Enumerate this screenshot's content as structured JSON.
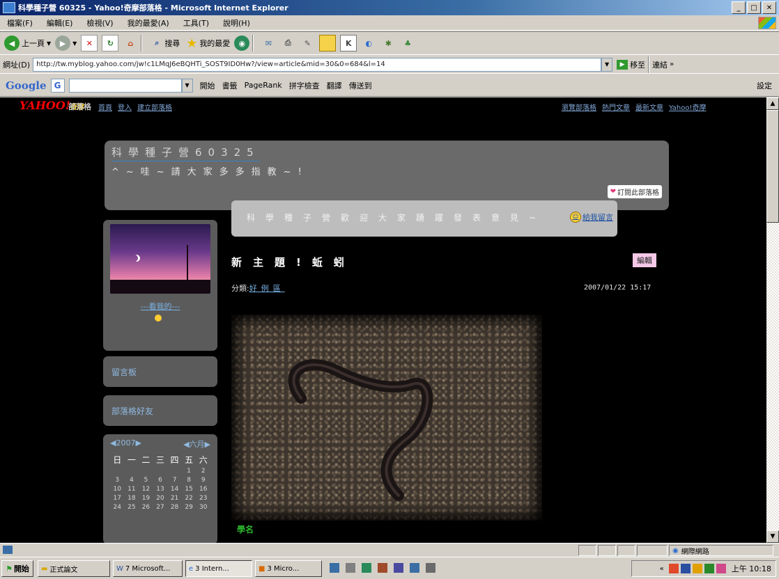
{
  "window": {
    "title": "科學種子營 60325 - Yahoo!奇摩部落格 - Microsoft Internet Explorer",
    "controls": [
      "_",
      "□",
      "✕"
    ]
  },
  "menu": [
    "檔案(F)",
    "編輯(E)",
    "檢視(V)",
    "我的最愛(A)",
    "工具(T)",
    "說明(H)"
  ],
  "toolbar": {
    "back_label": "上一頁",
    "search_label": "搜尋",
    "favorites_label": "我的最愛"
  },
  "address": {
    "label": "網址(D)",
    "url": "http://tw.myblog.yahoo.com/jw!c1LMqJ6eBQHTi_SOST9ID0Hw?/view=article&mid=30&0=684&l=14",
    "go_label": "移至",
    "links_label": "連結"
  },
  "google": {
    "logo": "Google",
    "g_label": "G",
    "items": [
      "開始",
      "書籤",
      "PageRank",
      "拼字檢查",
      "翻譯",
      "傳送到"
    ],
    "settings_label": "設定"
  },
  "yahoo": {
    "logo": "YAHOO!",
    "logo_sub": "奇摩",
    "service": "部落格",
    "links_left": [
      "首頁",
      "登入",
      "建立部落格"
    ],
    "links_right": [
      "瀏覽部落格",
      "熱門文章",
      "最新文章",
      "Yahoo!奇摩"
    ]
  },
  "blog": {
    "title": "科學種子營60325",
    "subtitle": "^~哇~請大家多多指教~!",
    "subscribe_label": "訂閱此部落格"
  },
  "bubble": {
    "text": "科學種子營歡迎大家踴躍發表意見~",
    "link_label": "給我留言"
  },
  "sidebar": {
    "profile_link": "---看我的---",
    "guestbook_label": "留言板",
    "friends_label": "部落格好友"
  },
  "calendar": {
    "year": "2007",
    "month": "六月",
    "weekdays": [
      "日",
      "一",
      "二",
      "三",
      "四",
      "五",
      "六"
    ],
    "rows": [
      [
        "",
        "",
        "",
        "",
        "",
        "1",
        "2"
      ],
      [
        "3",
        "4",
        "5",
        "6",
        "7",
        "8",
        "9"
      ],
      [
        "10",
        "11",
        "12",
        "13",
        "14",
        "15",
        "16"
      ],
      [
        "17",
        "18",
        "19",
        "20",
        "21",
        "22",
        "23"
      ],
      [
        "24",
        "25",
        "26",
        "27",
        "28",
        "29",
        "30"
      ]
    ]
  },
  "post": {
    "title": "新主題!蚯蚓",
    "edit_label": "編輯",
    "category_prefix": "分類:",
    "category": "好例區",
    "date": "2007/01/22 15:17",
    "caption": "學名"
  },
  "status": {
    "zone": "網際網路"
  },
  "taskbar": {
    "start_label": "開始",
    "tasks": [
      "正式論文",
      "7 Microsoft...",
      "3 Intern...",
      "3 Micro..."
    ],
    "clock": "上午 10:18"
  },
  "colors": {
    "page_bg": "#000000",
    "panel_bg": "#5b5b5b",
    "link": "#7ab2e6",
    "caption": "#2cb52c",
    "edit_bg": "#f6c9e8"
  }
}
